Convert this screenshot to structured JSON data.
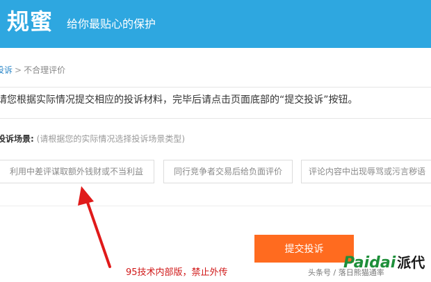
{
  "header": {
    "brand": "规蜜",
    "slogan": "给你最贴心的保护"
  },
  "breadcrumb": {
    "link": "投诉",
    "separator": ">",
    "current": "不合理评价"
  },
  "instruction": "请您根据实际情况提交相应的投诉材料，完毕后请点击页面底部的“提交投诉”按钮。",
  "scene": {
    "label": "投诉场景:",
    "hint": "(请根据您的实际情况选择投诉场景类型)",
    "options": [
      "利用中差评谋取额外钱财或不当利益",
      "同行竞争者交易后给负面评价",
      "评论内容中出现辱骂或污言秽语"
    ]
  },
  "submit_label": "提交投诉",
  "annotation": "95技术内部版，禁止外传",
  "source_credit": "头条号 / 落日熊猫通率",
  "logo": {
    "latin": "Paidai",
    "cn": "派代"
  },
  "colors": {
    "header_bg": "#2ea7e0",
    "submit_bg": "#ff6b1f",
    "arrow": "#e01a1a",
    "link": "#2a86c8"
  },
  "icons": {
    "annotation_arrow": "red-arrow-icon"
  }
}
